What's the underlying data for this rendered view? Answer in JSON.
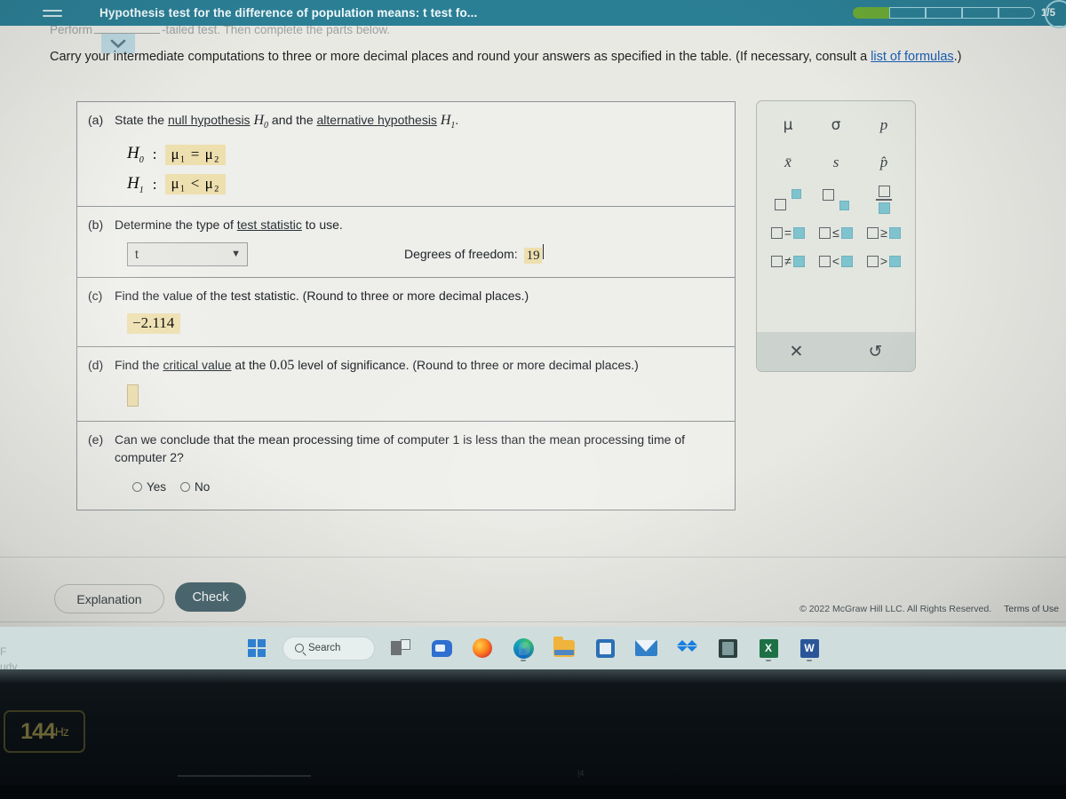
{
  "appbar": {
    "menu_icon": "hamburger-icon",
    "title": "Hypothesis test for the difference of population means: t test fo...",
    "progress_label": "1/5",
    "progress_total": 5,
    "progress_filled": 1,
    "accent_color": "#2b7f95",
    "progress_fill_color": "#6aa935"
  },
  "clipped": {
    "before": "Perform",
    "after": "-tailed test. Then complete the parts below.",
    "dropdown_icon": "chevron-down-icon"
  },
  "instruction": {
    "text_before": "Carry your intermediate computations to three or more decimal places and round your answers as specified in the table. (If necessary, consult a ",
    "link": "list of formulas",
    "text_after": ".)"
  },
  "question": {
    "parts": [
      {
        "tag": "(a)",
        "text_1": "State the ",
        "link_1": "null hypothesis",
        "sym_1": "H",
        "sym_1_sub": "0",
        "text_2": " and the ",
        "link_2": "alternative hypothesis",
        "sym_2": "H",
        "sym_2_sub": "1",
        "text_3": ".",
        "hypotheses": [
          {
            "name": "H",
            "sub": "0",
            "colon": ":",
            "answer": "μ₁ = μ₂"
          },
          {
            "name": "H",
            "sub": "1",
            "colon": ":",
            "answer": "μ₁ < μ₂"
          }
        ]
      },
      {
        "tag": "(b)",
        "text_1": "Determine the type of ",
        "link_1": "test statistic",
        "text_2": " to use.",
        "select_value": "t",
        "select_caret": "chevron-down-icon",
        "df_label": "Degrees of freedom:",
        "df_value": "19"
      },
      {
        "tag": "(c)",
        "text_1": "Find the value of the test statistic. (Round to three or more decimal places.)",
        "answer": "−2.114"
      },
      {
        "tag": "(d)",
        "text_1": "Find the ",
        "link_1": "critical value",
        "text_2": " at the ",
        "alpha": "0.05",
        "text_3": " level of significance. (Round to three or more decimal places.)",
        "answer": ""
      },
      {
        "tag": "(e)",
        "text_1": "Can we conclude that the mean processing time of computer 1 is less than the mean processing time of computer 2?",
        "options": [
          {
            "label": "Yes",
            "selected": false
          },
          {
            "label": "No",
            "selected": false
          }
        ]
      }
    ]
  },
  "palette": {
    "symbols": [
      {
        "name": "mu",
        "glyph": "μ"
      },
      {
        "name": "sigma",
        "glyph": "σ"
      },
      {
        "name": "p",
        "glyph": "p"
      },
      {
        "name": "x-bar",
        "glyph": "x̄"
      },
      {
        "name": "s",
        "glyph": "s"
      },
      {
        "name": "p-hat",
        "glyph": "p̂"
      },
      {
        "name": "superscript",
        "glyph": "□□"
      },
      {
        "name": "subscript",
        "glyph": "□□"
      },
      {
        "name": "fraction",
        "glyph": "□/□"
      },
      {
        "name": "equal",
        "glyph": "="
      },
      {
        "name": "less-or-equal",
        "glyph": "≤"
      },
      {
        "name": "greater-or-equal",
        "glyph": "≥"
      },
      {
        "name": "not-equal",
        "glyph": "≠"
      },
      {
        "name": "less-than",
        "glyph": "<"
      },
      {
        "name": "greater-than",
        "glyph": ">"
      }
    ],
    "clear_icon": "✕",
    "undo_icon": "↺",
    "accent_color": "#7fc3cf"
  },
  "actions": {
    "explanation": "Explanation",
    "check": "Check",
    "check_color": "#4e6b73"
  },
  "footer": {
    "copyright": "© 2022 McGraw Hill LLC. All Rights Reserved.",
    "terms": "Terms of Use"
  },
  "taskbar": {
    "search_placeholder": "Search",
    "items": [
      {
        "name": "start-button",
        "label": "Start"
      },
      {
        "name": "search-box",
        "label": "Search"
      },
      {
        "name": "task-view-button",
        "label": "Task View"
      },
      {
        "name": "chat-button",
        "label": "Chat"
      },
      {
        "name": "firefox-button",
        "label": "Firefox"
      },
      {
        "name": "edge-button",
        "label": "Microsoft Edge"
      },
      {
        "name": "file-explorer-button",
        "label": "File Explorer"
      },
      {
        "name": "microsoft-store-button",
        "label": "Microsoft Store"
      },
      {
        "name": "mail-button",
        "label": "Mail"
      },
      {
        "name": "dropbox-button",
        "label": "Dropbox"
      },
      {
        "name": "dark-app-button",
        "label": "App"
      },
      {
        "name": "excel-button",
        "label": "Excel"
      },
      {
        "name": "word-button",
        "label": "Word"
      }
    ],
    "excel_glyph": "X",
    "word_glyph": "W"
  },
  "desktop": {
    "clipped_line_1": "F",
    "clipped_line_2": "udy"
  },
  "monitor": {
    "refresh_badge": "144",
    "refresh_unit": "Hz"
  }
}
